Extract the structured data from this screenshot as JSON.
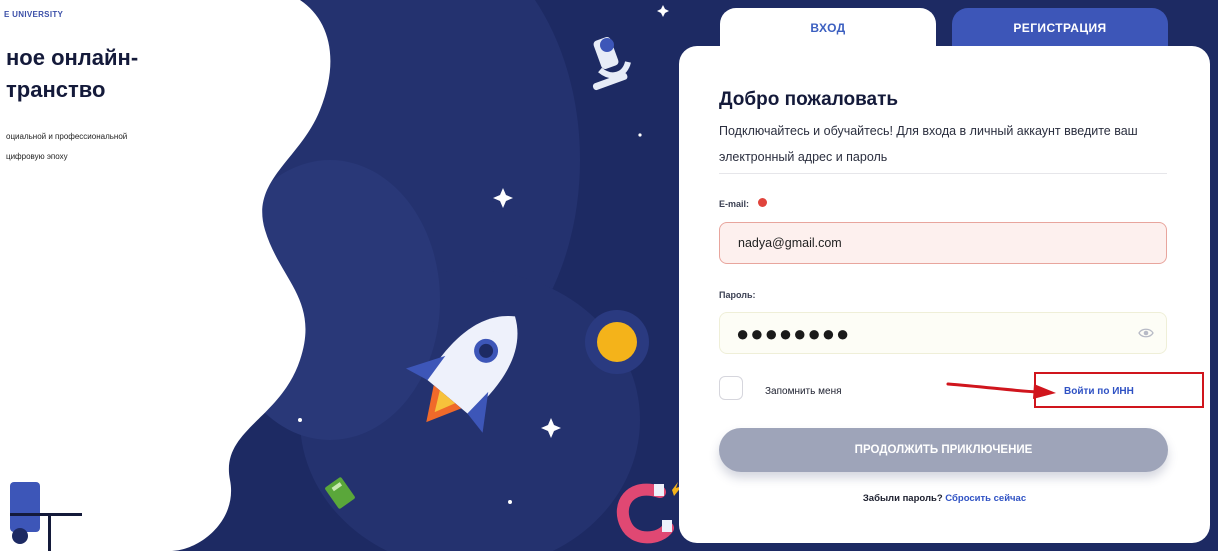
{
  "brand": {
    "name": "E UNIVERSITY"
  },
  "hero": {
    "title": "ное онлайн-\nтранство",
    "subtitle": "оциальной и профессиональной\nцифровую эпоху"
  },
  "tabs": [
    {
      "label": "ВХОД",
      "active": true
    },
    {
      "label": "РЕГИСТРАЦИЯ",
      "active": false
    }
  ],
  "form": {
    "heading": "Добро пожаловать",
    "intro": "Подключайтесь и обучайтесь! Для входа в личный аккаунт введите ваш электронный адрес и пароль",
    "email_label": "E-mail:",
    "email_value": "nadya@gmail.com",
    "password_label": "Пароль:",
    "password_value": "●●●●●●●●",
    "remember_label": "Запомнить меня",
    "inn_link": "Войти по ИНН",
    "submit_label": "ПРОДОЛЖИТЬ ПРИКЛЮЧЕНИЕ",
    "forgot_question": "Забыли пароль?",
    "reset_link": "Сбросить сейчас"
  },
  "icons": {
    "password_toggle": "eye-icon",
    "required": "error-dot-icon"
  },
  "colors": {
    "background": "#1d2a63",
    "accent": "#3d56b8",
    "link": "#2f52c4",
    "error": "#e0443c",
    "annotation": "#d0151d",
    "button_disabled": "#9ea4b9"
  }
}
